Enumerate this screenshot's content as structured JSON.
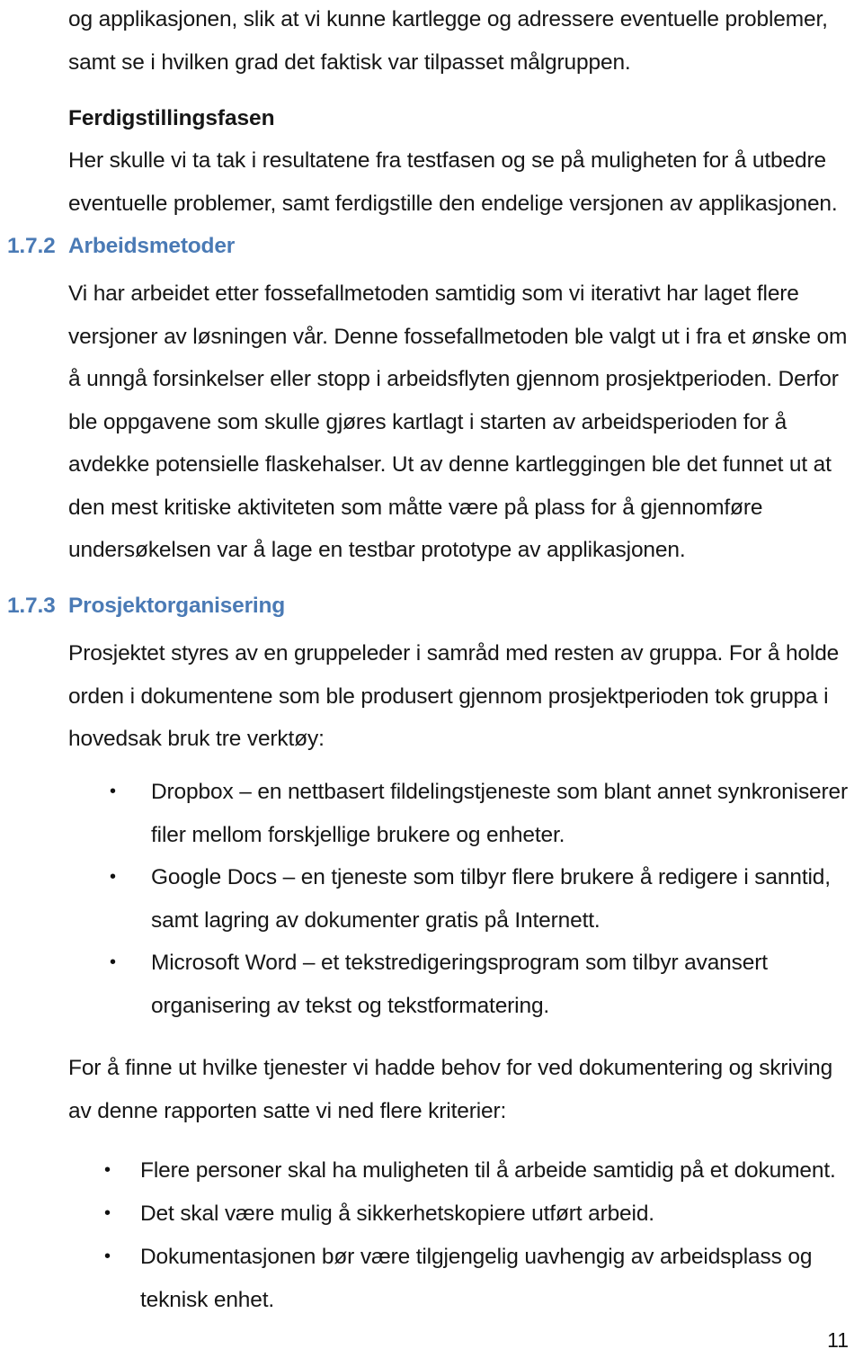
{
  "document": {
    "page_number": "11",
    "accent_color": "#4a7ab5",
    "text_color": "#161616",
    "bullet_glyph": "•"
  },
  "blocks": {
    "continued_paragraph": {
      "text": "og applikasjonen, slik at vi kunne kartlegge og adressere eventuelle problemer, samt se i hvilken grad det faktisk var tilpasset målgruppen."
    },
    "subheading_ferdigstillingsfasen": {
      "text": "Ferdigstillingsfasen"
    },
    "ferdigstillingsfasen_paragraph": {
      "text": "Her skulle vi ta tak i resultatene fra testfasen og se på muligheten for å utbedre eventuelle problemer, samt ferdigstille den endelige versjonen av applikasjonen."
    },
    "heading_172": {
      "number": "1.7.2",
      "title": "Arbeidsmetoder"
    },
    "arbeidsmetoder_paragraph": {
      "text": "Vi har arbeidet etter fossefallmetoden samtidig som vi iterativt har laget flere versjoner av løsningen vår. Denne fossefallmetoden ble valgt ut i fra et ønske om å unngå forsinkelser eller stopp i arbeidsflyten gjennom prosjektperioden. Derfor ble oppgavene som skulle gjøres kartlagt i starten av arbeidsperioden for å avdekke potensielle flaskehalser. Ut av denne kartleggingen ble det funnet ut at den mest kritiske aktiviteten som måtte være på plass for å gjennomføre undersøkelsen var å lage en testbar prototype av applikasjonen."
    },
    "heading_173": {
      "number": "1.7.3",
      "title": "Prosjektorganisering"
    },
    "prosjektorganisering_paragraph": {
      "text": "Prosjektet styres av en gruppeleder i samråd med resten av gruppa. For å holde orden i dokumentene som ble produsert gjennom prosjektperioden tok gruppa i hovedsak bruk tre verktøy:"
    },
    "tools_list": {
      "items": [
        "Dropbox – en nettbasert fildelingstjeneste som blant annet synkroniserer filer mellom forskjellige brukere og enheter.",
        "Google Docs – en tjeneste som tilbyr flere brukere å redigere i sanntid, samt lagring av dokumenter gratis på Internett.",
        "Microsoft Word – et tekstredigeringsprogram som tilbyr avansert organisering av tekst og tekstformatering."
      ]
    },
    "criteria_intro_paragraph": {
      "text": "For å finne ut hvilke tjenester vi hadde behov for ved dokumentering og skriving av denne rapporten satte vi ned flere kriterier:"
    },
    "criteria_list": {
      "items": [
        "Flere personer skal ha muligheten til å arbeide samtidig på et dokument.",
        "Det skal være mulig å sikkerhetskopiere utført arbeid.",
        "Dokumentasjonen bør være tilgjengelig uavhengig av arbeidsplass og teknisk enhet."
      ]
    }
  }
}
